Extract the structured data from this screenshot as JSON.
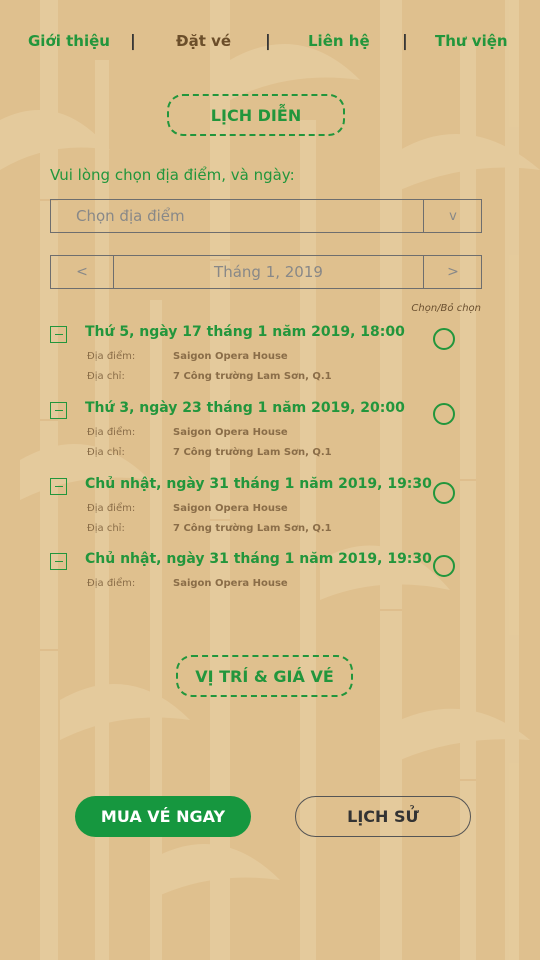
{
  "colors": {
    "background": "#dfc08e",
    "accent_green": "#22963c",
    "active_nav": "#6b4e2a",
    "primary_button": "#16973f"
  },
  "nav": {
    "items": [
      {
        "label": "Giới thiệu",
        "active": false
      },
      {
        "label": "Đặt vé",
        "active": true
      },
      {
        "label": "Liên hệ",
        "active": false
      },
      {
        "label": "Thư viện",
        "active": false
      }
    ],
    "separator": "|"
  },
  "schedule_heading": "LỊCH DIỄN",
  "prompt": "Vui lòng chọn địa điểm, và ngày:",
  "location_select": {
    "placeholder": "Chọn địa điểm",
    "arrow": "v"
  },
  "month_nav": {
    "prev": "<",
    "label": "Tháng 1, 2019",
    "next": ">"
  },
  "toggle_label": "Chọn/Bỏ chọn",
  "events": [
    {
      "title": "Thứ 5, ngày 17 tháng 1 năm 2019, 18:00",
      "venue_label": "Địa điểm:",
      "venue": "Saigon Opera House",
      "address_label": "Địa chỉ:",
      "address": "7 Công trường Lam Sơn, Q.1",
      "selected": false
    },
    {
      "title": "Thứ 3, ngày 23 tháng 1 năm 2019, 20:00",
      "venue_label": "Địa điểm:",
      "venue": "Saigon Opera House",
      "address_label": "Địa chỉ:",
      "address": "7 Công trường Lam Sơn, Q.1",
      "selected": false
    },
    {
      "title": "Chủ nhật, ngày 31 tháng 1 năm 2019, 19:30",
      "venue_label": "Địa điểm:",
      "venue": "Saigon Opera House",
      "address_label": "Địa chỉ:",
      "address": "7 Công trường Lam Sơn, Q.1",
      "selected": false
    },
    {
      "title": "Chủ nhật, ngày 31 tháng 1 năm 2019, 19:30",
      "venue_label": "Địa điểm:",
      "venue": "Saigon Opera House",
      "selected": false
    }
  ],
  "location_price_button": "VỊ TRÍ & GIÁ VÉ",
  "buy_button": "MUA VÉ NGAY",
  "history_button": "LỊCH SỬ",
  "icons": {
    "collapse": "minus-square-icon",
    "radio": "radio-circle-icon",
    "background": "bamboo-pattern"
  }
}
